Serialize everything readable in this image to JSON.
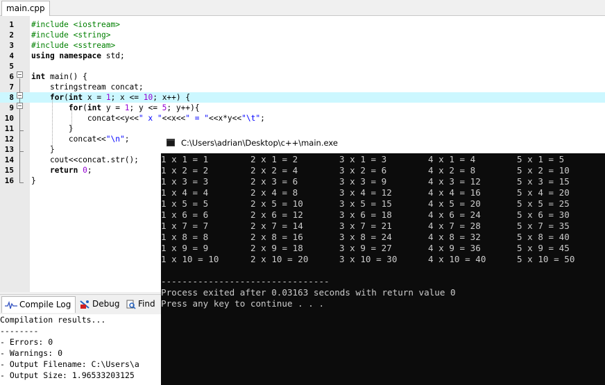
{
  "editor": {
    "tab_label": "main.cpp",
    "lines": [
      {
        "n": "1",
        "segs": [
          {
            "c": "pp",
            "t": "#include <iostream>"
          }
        ]
      },
      {
        "n": "2",
        "segs": [
          {
            "c": "pp",
            "t": "#include <string>"
          }
        ]
      },
      {
        "n": "3",
        "segs": [
          {
            "c": "pp",
            "t": "#include <sstream>"
          }
        ]
      },
      {
        "n": "4",
        "segs": [
          {
            "c": "kw",
            "t": "using namespace"
          },
          {
            "c": "",
            "t": " std;"
          }
        ]
      },
      {
        "n": "5",
        "segs": []
      },
      {
        "n": "6",
        "segs": [
          {
            "c": "kw",
            "t": "int"
          },
          {
            "c": "",
            "t": " main() {"
          }
        ]
      },
      {
        "n": "7",
        "segs": [
          {
            "c": "",
            "t": "    stringstream concat;"
          }
        ]
      },
      {
        "n": "8",
        "segs": [
          {
            "c": "",
            "t": "    "
          },
          {
            "c": "kw",
            "t": "for"
          },
          {
            "c": "",
            "t": "("
          },
          {
            "c": "kw",
            "t": "int"
          },
          {
            "c": "",
            "t": " x = "
          },
          {
            "c": "num",
            "t": "1"
          },
          {
            "c": "",
            "t": "; x <= "
          },
          {
            "c": "num",
            "t": "10"
          },
          {
            "c": "",
            "t": "; x++) {"
          }
        ]
      },
      {
        "n": "9",
        "segs": [
          {
            "c": "",
            "t": "        "
          },
          {
            "c": "kw",
            "t": "for"
          },
          {
            "c": "",
            "t": "("
          },
          {
            "c": "kw",
            "t": "int"
          },
          {
            "c": "",
            "t": " y = "
          },
          {
            "c": "num",
            "t": "1"
          },
          {
            "c": "",
            "t": "; y <= "
          },
          {
            "c": "num",
            "t": "5"
          },
          {
            "c": "",
            "t": "; y++){"
          }
        ]
      },
      {
        "n": "10",
        "segs": [
          {
            "c": "",
            "t": "            concat<<y<<"
          },
          {
            "c": "st",
            "t": "\" x \""
          },
          {
            "c": "",
            "t": "<<x<<"
          },
          {
            "c": "st",
            "t": "\" = \""
          },
          {
            "c": "",
            "t": "<<x*y<<"
          },
          {
            "c": "st",
            "t": "\"\\t\""
          },
          {
            "c": "",
            "t": ";"
          }
        ]
      },
      {
        "n": "11",
        "segs": [
          {
            "c": "",
            "t": "        }"
          }
        ]
      },
      {
        "n": "12",
        "segs": [
          {
            "c": "",
            "t": "        concat<<"
          },
          {
            "c": "st",
            "t": "\"\\n\""
          },
          {
            "c": "",
            "t": ";"
          }
        ]
      },
      {
        "n": "13",
        "segs": [
          {
            "c": "",
            "t": "    }"
          }
        ]
      },
      {
        "n": "14",
        "segs": [
          {
            "c": "",
            "t": "    cout<<concat.str();"
          }
        ]
      },
      {
        "n": "15",
        "segs": [
          {
            "c": "",
            "t": "    "
          },
          {
            "c": "kw",
            "t": "return"
          },
          {
            "c": "",
            "t": " "
          },
          {
            "c": "num",
            "t": "0"
          },
          {
            "c": "",
            "t": ";"
          }
        ]
      },
      {
        "n": "16",
        "segs": [
          {
            "c": "",
            "t": "}"
          }
        ]
      }
    ],
    "highlighted_line": "8"
  },
  "bottom_panel": {
    "tabs": [
      {
        "label": "Compile Log",
        "icon": "compile-log-icon",
        "active": true
      },
      {
        "label": "Debug",
        "icon": "debug-icon",
        "active": false
      },
      {
        "label": "Find",
        "icon": "find-icon",
        "active": false
      }
    ],
    "log_lines": [
      "Compilation results...",
      "--------",
      "- Errors: 0",
      "- Warnings: 0",
      "- Output Filename: C:\\Users\\a",
      "- Output Size: 1.96533203125 "
    ]
  },
  "console": {
    "title": "C:\\Users\\adrian\\Desktop\\c++\\main.exe",
    "table": [
      [
        "1 x 1 = 1",
        "2 x 1 = 2",
        "3 x 1 = 3",
        "4 x 1 = 4",
        "5 x 1 = 5"
      ],
      [
        "1 x 2 = 2",
        "2 x 2 = 4",
        "3 x 2 = 6",
        "4 x 2 = 8",
        "5 x 2 = 10"
      ],
      [
        "1 x 3 = 3",
        "2 x 3 = 6",
        "3 x 3 = 9",
        "4 x 3 = 12",
        "5 x 3 = 15"
      ],
      [
        "1 x 4 = 4",
        "2 x 4 = 8",
        "3 x 4 = 12",
        "4 x 4 = 16",
        "5 x 4 = 20"
      ],
      [
        "1 x 5 = 5",
        "2 x 5 = 10",
        "3 x 5 = 15",
        "4 x 5 = 20",
        "5 x 5 = 25"
      ],
      [
        "1 x 6 = 6",
        "2 x 6 = 12",
        "3 x 6 = 18",
        "4 x 6 = 24",
        "5 x 6 = 30"
      ],
      [
        "1 x 7 = 7",
        "2 x 7 = 14",
        "3 x 7 = 21",
        "4 x 7 = 28",
        "5 x 7 = 35"
      ],
      [
        "1 x 8 = 8",
        "2 x 8 = 16",
        "3 x 8 = 24",
        "4 x 8 = 32",
        "5 x 8 = 40"
      ],
      [
        "1 x 9 = 9",
        "2 x 9 = 18",
        "3 x 9 = 27",
        "4 x 9 = 36",
        "5 x 9 = 45"
      ],
      [
        "1 x 10 = 10",
        "2 x 10 = 20",
        "3 x 10 = 30",
        "4 x 10 = 40",
        "5 x 10 = 50"
      ]
    ],
    "separator": "--------------------------------",
    "exit_message": "Process exited after 0.03163 seconds with return value 0",
    "prompt": "Press any key to continue . . ."
  }
}
